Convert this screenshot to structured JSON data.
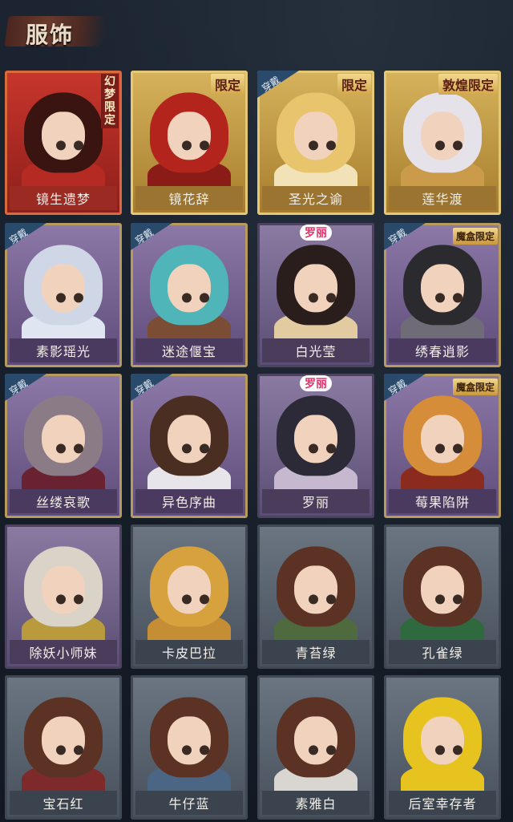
{
  "title": "服饰",
  "cards": [
    {
      "name": "镜生遗梦",
      "style": "red",
      "tag_type": "vert",
      "tag": "幻梦限定",
      "hair": "#3a1410",
      "body": "#b52b23"
    },
    {
      "name": "镜花辞",
      "style": "gold",
      "tag_type": "limit",
      "tag": "限定",
      "hair": "#b3241c",
      "body": "#8a1b16"
    },
    {
      "name": "圣光之谕",
      "style": "gold",
      "tag_type": "limit",
      "tag": "限定",
      "wear": "穿戴",
      "hair": "#e8c46d",
      "body": "#f1e2b8"
    },
    {
      "name": "莲华渡",
      "style": "gold",
      "tag_type": "limit",
      "tag": "敦煌限定",
      "hair": "#e6e2ea",
      "body": "#c99b4a"
    },
    {
      "name": "素影瑶光",
      "style": "purple",
      "wear": "穿戴",
      "hair": "#cfd7e6",
      "body": "#dfe6f1"
    },
    {
      "name": "迷途偃宝",
      "style": "purple",
      "wear": "穿戴",
      "hair": "#4fb5b8",
      "body": "#7b4d35"
    },
    {
      "name": "白光莹",
      "style": "lilac",
      "tag_type": "luoli",
      "tag": "罗丽",
      "hair": "#2a1e1c",
      "body": "#e2cba0"
    },
    {
      "name": "绣春逍影",
      "style": "purple",
      "tag_type": "box",
      "tag": "魔盒限定",
      "wear": "穿戴",
      "hair": "#2b2a2e",
      "body": "#6f6c78"
    },
    {
      "name": "丝缕哀歌",
      "style": "purple",
      "wear": "穿戴",
      "hair": "#8a7b87",
      "body": "#6a2230"
    },
    {
      "name": "异色序曲",
      "style": "purple",
      "wear": "穿戴",
      "hair": "#4a2e22",
      "body": "#e7e5ea"
    },
    {
      "name": "罗丽",
      "style": "lilac",
      "tag_type": "luoli",
      "tag": "罗丽",
      "hair": "#2b2a36",
      "body": "#c6b9cf"
    },
    {
      "name": "莓果陷阱",
      "style": "purple",
      "tag_type": "box",
      "tag": "魔盒限定",
      "wear": "穿戴",
      "hair": "#d68d39",
      "body": "#8a2b1e"
    },
    {
      "name": "除妖小师妹",
      "style": "lilac",
      "hair": "#d9d3c8",
      "body": "#b99a3d"
    },
    {
      "name": "卡皮巴拉",
      "style": "grey",
      "hair": "#d7a23d",
      "body": "#c58e34"
    },
    {
      "name": "青苔绿",
      "style": "grey",
      "hair": "#5b3223",
      "body": "#4f6a3f"
    },
    {
      "name": "孔雀绿",
      "style": "grey",
      "hair": "#5b3223",
      "body": "#2f6a3e"
    },
    {
      "name": "宝石红",
      "style": "grey",
      "hair": "#5b3223",
      "body": "#7e2a2a"
    },
    {
      "name": "牛仔蓝",
      "style": "grey",
      "hair": "#5b3223",
      "body": "#4a6684"
    },
    {
      "name": "素雅白",
      "style": "grey",
      "hair": "#5b3223",
      "body": "#d9d6d2"
    },
    {
      "name": "后室幸存者",
      "style": "grey",
      "hair": "#e6c31f",
      "body": "#e6c31f"
    }
  ]
}
